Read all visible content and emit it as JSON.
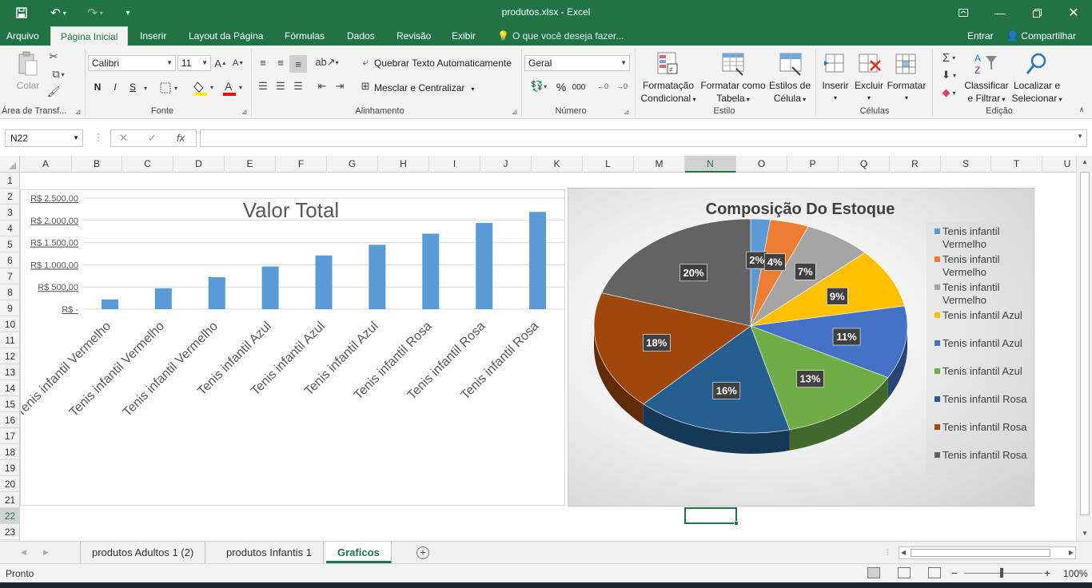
{
  "window": {
    "title": "produtos.xlsx - Excel",
    "quick_access": {
      "save_icon": "save-icon",
      "undo_icon": "undo-icon",
      "redo_icon": "redo-icon",
      "customize_icon": "customize-icon"
    }
  },
  "tabs": [
    {
      "label": "Arquivo"
    },
    {
      "label": "Página Inicial",
      "active": true
    },
    {
      "label": "Inserir"
    },
    {
      "label": "Layout da Página"
    },
    {
      "label": "Fórmulas"
    },
    {
      "label": "Dados"
    },
    {
      "label": "Revisão"
    },
    {
      "label": "Exibir"
    }
  ],
  "tellme": "O que você deseja fazer...",
  "account": {
    "signin": "Entrar",
    "share": "Compartilhar"
  },
  "ribbon": {
    "clipboard": {
      "paste": "Colar",
      "label": "Área de Transf..."
    },
    "font": {
      "name": "Calibri",
      "size": "11",
      "label": "Fonte",
      "bold": "N",
      "italic": "I",
      "underline": "S"
    },
    "alignment": {
      "wrap": "Quebrar Texto Automaticamente",
      "merge": "Mesclar e Centralizar",
      "label": "Alinhamento"
    },
    "number": {
      "format": "Geral",
      "percent": "%",
      "thousands": "000",
      "label": "Número"
    },
    "styles": {
      "conditional": [
        "Formatação",
        "Condicional"
      ],
      "table": [
        "Formatar como",
        "Tabela"
      ],
      "cell": [
        "Estilos de",
        "Célula"
      ],
      "label": "Estilo"
    },
    "cells": {
      "insert": "Inserir",
      "delete": "Excluir",
      "format": "Formatar",
      "label": "Células"
    },
    "editing": {
      "sort": [
        "Classificar",
        "e Filtrar"
      ],
      "find": [
        "Localizar e",
        "Selecionar"
      ],
      "label": "Edição"
    }
  },
  "formula_bar": {
    "name_box": "N22",
    "fx": "fx",
    "formula": ""
  },
  "columns": [
    "A",
    "B",
    "C",
    "D",
    "E",
    "F",
    "G",
    "H",
    "I",
    "J",
    "K",
    "L",
    "M",
    "N",
    "O",
    "P",
    "Q",
    "R",
    "S",
    "T",
    "U"
  ],
  "selected_column": "N",
  "rows": [
    "1",
    "2",
    "3",
    "4",
    "5",
    "6",
    "7",
    "8",
    "9",
    "10",
    "11",
    "12",
    "13",
    "14",
    "15",
    "16",
    "17",
    "18",
    "19",
    "20",
    "21",
    "22",
    "23"
  ],
  "selected_row": "22",
  "chart_data": [
    {
      "type": "bar",
      "title": "Valor Total",
      "categories": [
        "Tenis infantil Vermelho",
        "Tenis infantil Vermelho",
        "Tenis infantil Vermelho",
        "Tenis infantil Azul",
        "Tenis infantil Azul",
        "Tenis infantil Azul",
        "Tenis infantil Rosa",
        "Tenis infantil Rosa",
        "Tenis infantil Rosa"
      ],
      "values": [
        220,
        470,
        720,
        960,
        1210,
        1450,
        1700,
        1940,
        2190
      ],
      "ylim": [
        0,
        2500
      ],
      "ytick_values": [
        0,
        500,
        1000,
        1500,
        2000,
        2500
      ],
      "ytick_labels": [
        "R$ -",
        "R$ 500,00",
        "R$ 1.000,00",
        "R$ 1.500,00",
        "R$ 2.000,00",
        "R$ 2.500,00"
      ],
      "grid": true,
      "color": "#5b9bd5"
    },
    {
      "type": "pie",
      "title": "Composição Do Estoque",
      "labels": [
        "Tenis infantil Vermelho",
        "Tenis infantil Vermelho",
        "Tenis infantil Vermelho",
        "Tenis infantil Azul",
        "Tenis infantil Azul",
        "Tenis infantil Azul",
        "Tenis infantil Rosa",
        "Tenis infantil Rosa",
        "Tenis infantil Rosa"
      ],
      "values": [
        2,
        4,
        7,
        9,
        11,
        13,
        16,
        18,
        20
      ],
      "data_labels": [
        "2%",
        "4%",
        "7%",
        "9%",
        "11%",
        "13%",
        "16%",
        "18%",
        "20%"
      ],
      "colors": [
        "#5b9bd5",
        "#ed7d31",
        "#a5a5a5",
        "#ffc000",
        "#4472c4",
        "#70ad47",
        "#255e91",
        "#9e480e",
        "#636363"
      ],
      "legend": "right"
    }
  ],
  "sheets": [
    {
      "label": "produtos Adultos  1 (2)"
    },
    {
      "label": "produtos Infantis 1"
    },
    {
      "label": "Graficos",
      "active": true
    }
  ],
  "status": {
    "ready": "Pronto",
    "zoom": "100%"
  }
}
